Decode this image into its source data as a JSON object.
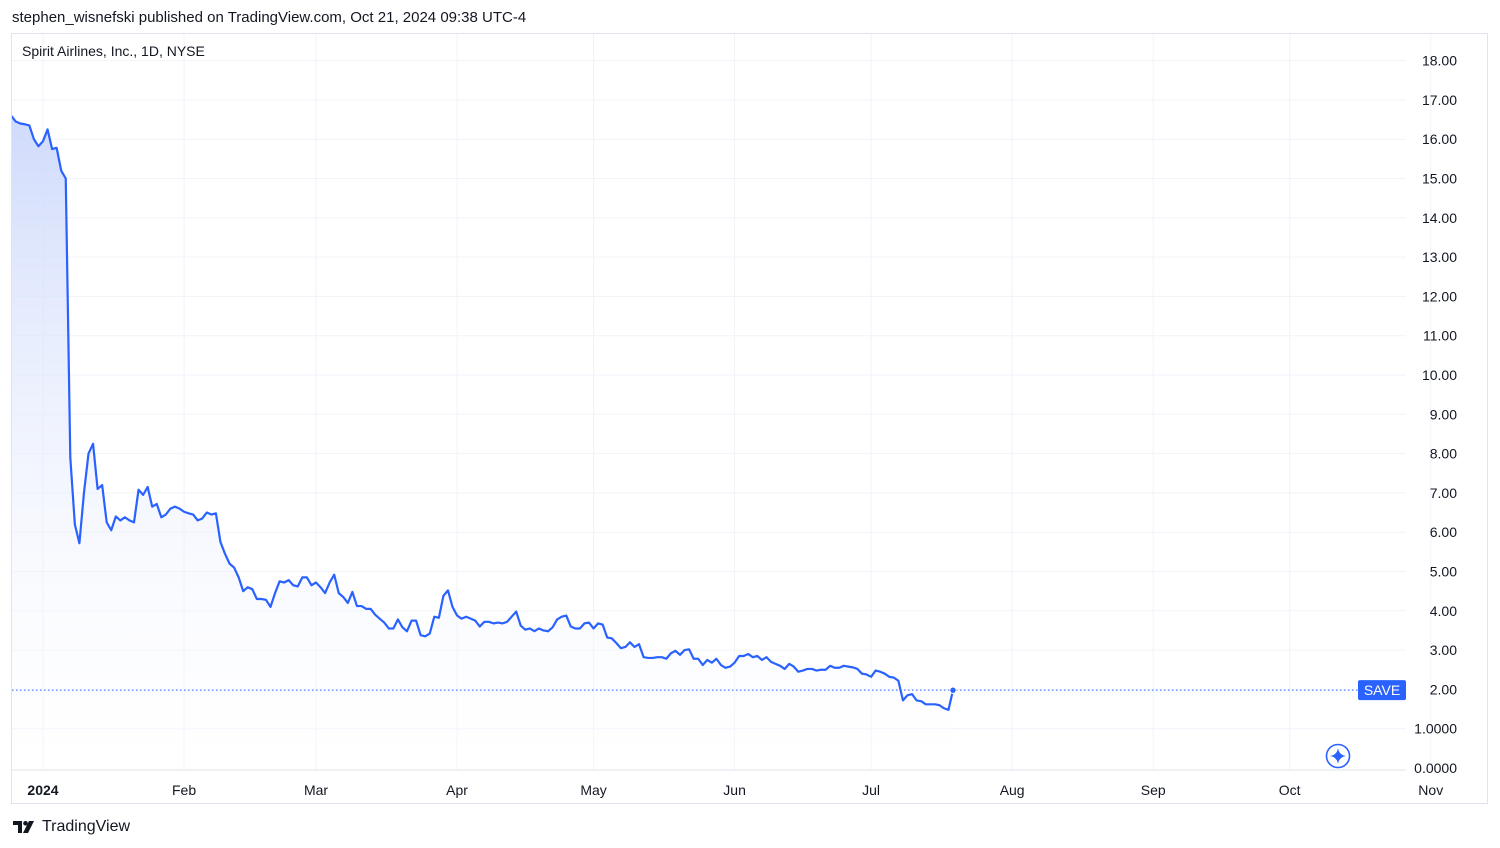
{
  "header": {
    "publisher_line": "stephen_wisnefski published on TradingView.com, Oct 21, 2024 09:38 UTC-4"
  },
  "chart": {
    "symbol_line": "Spirit Airlines, Inc., 1D, NYSE",
    "price_badge": "SAVE",
    "colors": {
      "line": "#2962ff",
      "fill_top": "#c9d6fb",
      "fill_bottom": "#ffffff",
      "grid": "#f0f3fa",
      "axis_text": "#131722"
    }
  },
  "footer": {
    "brand": "TradingView",
    "brand_icon": "tradingview-logo-icon"
  },
  "chart_data": {
    "type": "area",
    "title": "Spirit Airlines, Inc., 1D, NYSE",
    "ylim": [
      0,
      18
    ],
    "y_ticks": [
      "0.0000",
      "1.0000",
      "2.00",
      "3.00",
      "4.00",
      "5.00",
      "6.00",
      "7.00",
      "8.00",
      "9.00",
      "10.00",
      "11.00",
      "12.00",
      "13.00",
      "14.00",
      "15.00",
      "16.00",
      "17.00",
      "18.00"
    ],
    "x_ticks": [
      "2024",
      "Feb",
      "Mar",
      "Apr",
      "May",
      "Jun",
      "Jul",
      "Aug",
      "Sep",
      "Oct",
      "Nov"
    ],
    "x_tick_days": [
      0,
      31,
      60,
      91,
      121,
      152,
      182,
      213,
      244,
      274,
      305
    ],
    "grid": true,
    "last_value": 1.98,
    "series": [
      {
        "values": [
          [
            -8,
            16.85
          ],
          [
            -7,
            16.6
          ],
          [
            -6,
            16.45
          ],
          [
            -5,
            16.4
          ],
          [
            -4,
            16.38
          ],
          [
            -3,
            16.35
          ],
          [
            -2,
            16.0
          ],
          [
            -1,
            15.82
          ],
          [
            0,
            15.95
          ],
          [
            1,
            16.25
          ],
          [
            2,
            15.75
          ],
          [
            3,
            15.78
          ],
          [
            4,
            15.2
          ],
          [
            5,
            15.0
          ],
          [
            6,
            7.9
          ],
          [
            7,
            6.2
          ],
          [
            8,
            5.72
          ],
          [
            9,
            7.0
          ],
          [
            10,
            8.0
          ],
          [
            11,
            8.25
          ],
          [
            12,
            7.1
          ],
          [
            13,
            7.2
          ],
          [
            14,
            6.25
          ],
          [
            15,
            6.05
          ],
          [
            16,
            6.4
          ],
          [
            17,
            6.3
          ],
          [
            18,
            6.38
          ],
          [
            19,
            6.3
          ],
          [
            20,
            6.25
          ],
          [
            21,
            7.08
          ],
          [
            22,
            6.95
          ],
          [
            23,
            7.15
          ],
          [
            24,
            6.65
          ],
          [
            25,
            6.72
          ],
          [
            26,
            6.38
          ],
          [
            27,
            6.45
          ],
          [
            28,
            6.6
          ],
          [
            29,
            6.65
          ],
          [
            30,
            6.6
          ],
          [
            31,
            6.52
          ],
          [
            32,
            6.48
          ],
          [
            33,
            6.45
          ],
          [
            34,
            6.3
          ],
          [
            35,
            6.35
          ],
          [
            36,
            6.5
          ],
          [
            37,
            6.45
          ],
          [
            38,
            6.48
          ],
          [
            39,
            5.75
          ],
          [
            40,
            5.45
          ],
          [
            41,
            5.2
          ],
          [
            42,
            5.1
          ],
          [
            43,
            4.85
          ],
          [
            44,
            4.5
          ],
          [
            45,
            4.6
          ],
          [
            46,
            4.55
          ],
          [
            47,
            4.3
          ],
          [
            48,
            4.3
          ],
          [
            49,
            4.28
          ],
          [
            50,
            4.1
          ],
          [
            51,
            4.45
          ],
          [
            52,
            4.75
          ],
          [
            53,
            4.72
          ],
          [
            54,
            4.78
          ],
          [
            55,
            4.65
          ],
          [
            56,
            4.62
          ],
          [
            57,
            4.85
          ],
          [
            58,
            4.85
          ],
          [
            59,
            4.65
          ],
          [
            60,
            4.72
          ],
          [
            61,
            4.6
          ],
          [
            62,
            4.45
          ],
          [
            63,
            4.72
          ],
          [
            64,
            4.92
          ],
          [
            65,
            4.45
          ],
          [
            66,
            4.35
          ],
          [
            67,
            4.2
          ],
          [
            68,
            4.48
          ],
          [
            69,
            4.12
          ],
          [
            70,
            4.12
          ],
          [
            71,
            4.05
          ],
          [
            72,
            4.05
          ],
          [
            73,
            3.9
          ],
          [
            74,
            3.8
          ],
          [
            75,
            3.7
          ],
          [
            76,
            3.55
          ],
          [
            77,
            3.55
          ],
          [
            78,
            3.78
          ],
          [
            79,
            3.58
          ],
          [
            80,
            3.48
          ],
          [
            81,
            3.75
          ],
          [
            82,
            3.75
          ],
          [
            83,
            3.38
          ],
          [
            84,
            3.35
          ],
          [
            85,
            3.42
          ],
          [
            86,
            3.85
          ],
          [
            87,
            3.82
          ],
          [
            88,
            4.38
          ],
          [
            89,
            4.52
          ],
          [
            90,
            4.1
          ],
          [
            91,
            3.88
          ],
          [
            92,
            3.8
          ],
          [
            93,
            3.85
          ],
          [
            94,
            3.8
          ],
          [
            95,
            3.75
          ],
          [
            96,
            3.6
          ],
          [
            97,
            3.72
          ],
          [
            98,
            3.72
          ],
          [
            99,
            3.68
          ],
          [
            100,
            3.7
          ],
          [
            101,
            3.68
          ],
          [
            102,
            3.72
          ],
          [
            103,
            3.85
          ],
          [
            104,
            3.98
          ],
          [
            105,
            3.62
          ],
          [
            106,
            3.52
          ],
          [
            107,
            3.55
          ],
          [
            108,
            3.48
          ],
          [
            109,
            3.55
          ],
          [
            110,
            3.5
          ],
          [
            111,
            3.48
          ],
          [
            112,
            3.58
          ],
          [
            113,
            3.78
          ],
          [
            114,
            3.85
          ],
          [
            115,
            3.88
          ],
          [
            116,
            3.6
          ],
          [
            117,
            3.55
          ],
          [
            118,
            3.55
          ],
          [
            119,
            3.68
          ],
          [
            120,
            3.7
          ],
          [
            121,
            3.55
          ],
          [
            122,
            3.68
          ],
          [
            123,
            3.65
          ],
          [
            124,
            3.32
          ],
          [
            125,
            3.3
          ],
          [
            126,
            3.18
          ],
          [
            127,
            3.05
          ],
          [
            128,
            3.08
          ],
          [
            129,
            3.2
          ],
          [
            130,
            3.08
          ],
          [
            131,
            3.15
          ],
          [
            132,
            2.82
          ],
          [
            133,
            2.8
          ],
          [
            134,
            2.8
          ],
          [
            135,
            2.82
          ],
          [
            136,
            2.82
          ],
          [
            137,
            2.78
          ],
          [
            138,
            2.92
          ],
          [
            139,
            2.98
          ],
          [
            140,
            2.88
          ],
          [
            141,
            3.0
          ],
          [
            142,
            3.02
          ],
          [
            143,
            2.78
          ],
          [
            144,
            2.78
          ],
          [
            145,
            2.62
          ],
          [
            146,
            2.75
          ],
          [
            147,
            2.68
          ],
          [
            148,
            2.78
          ],
          [
            149,
            2.62
          ],
          [
            150,
            2.55
          ],
          [
            151,
            2.58
          ],
          [
            152,
            2.68
          ],
          [
            153,
            2.85
          ],
          [
            154,
            2.85
          ],
          [
            155,
            2.9
          ],
          [
            156,
            2.82
          ],
          [
            157,
            2.85
          ],
          [
            158,
            2.75
          ],
          [
            159,
            2.82
          ],
          [
            160,
            2.7
          ],
          [
            161,
            2.65
          ],
          [
            162,
            2.6
          ],
          [
            163,
            2.52
          ],
          [
            164,
            2.65
          ],
          [
            165,
            2.58
          ],
          [
            166,
            2.45
          ],
          [
            167,
            2.48
          ],
          [
            168,
            2.52
          ],
          [
            169,
            2.52
          ],
          [
            170,
            2.48
          ],
          [
            171,
            2.5
          ],
          [
            172,
            2.5
          ],
          [
            173,
            2.6
          ],
          [
            174,
            2.55
          ],
          [
            175,
            2.55
          ],
          [
            176,
            2.6
          ],
          [
            177,
            2.58
          ],
          [
            178,
            2.56
          ],
          [
            179,
            2.52
          ],
          [
            180,
            2.4
          ],
          [
            181,
            2.38
          ],
          [
            182,
            2.32
          ],
          [
            183,
            2.48
          ],
          [
            184,
            2.45
          ],
          [
            185,
            2.4
          ],
          [
            186,
            2.32
          ],
          [
            187,
            2.3
          ],
          [
            188,
            2.22
          ],
          [
            189,
            1.72
          ],
          [
            190,
            1.85
          ],
          [
            191,
            1.88
          ],
          [
            192,
            1.72
          ],
          [
            193,
            1.7
          ],
          [
            194,
            1.62
          ],
          [
            195,
            1.62
          ],
          [
            196,
            1.62
          ],
          [
            197,
            1.6
          ],
          [
            198,
            1.52
          ],
          [
            199,
            1.48
          ],
          [
            200,
            1.98
          ]
        ]
      }
    ]
  }
}
